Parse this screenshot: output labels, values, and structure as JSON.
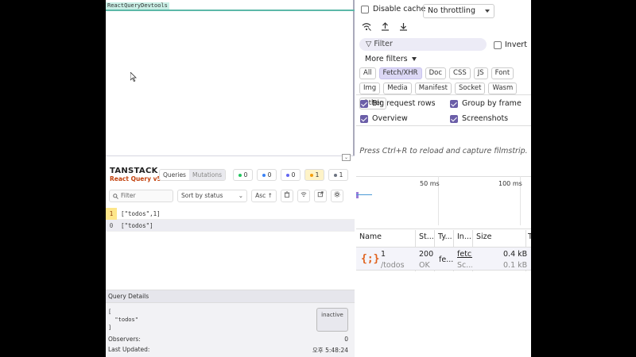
{
  "app": {
    "tab_title": "ReactQueryDevtools"
  },
  "react_query": {
    "brand_top": "TANSTACK",
    "brand_bottom": "React Query v5",
    "toggle_icon": "chevron-down-icon",
    "tabs": [
      {
        "label": "Queries",
        "active": true
      },
      {
        "label": "Mutations",
        "active": false
      }
    ],
    "counts": [
      {
        "value": "0",
        "color": "#22c55e"
      },
      {
        "value": "0",
        "color": "#3b82f6"
      },
      {
        "value": "0",
        "color": "#6366f1"
      },
      {
        "value": "1",
        "color": "#f59e0b"
      },
      {
        "value": "1",
        "color": "#6b7280"
      }
    ],
    "filter_placeholder": "Filter",
    "sort_label": "Sort by status",
    "asc_label": "Asc ↑",
    "rows": [
      {
        "count": "1",
        "key": "[\"todos\",1]"
      },
      {
        "count": "0",
        "key": "[\"todos\"]"
      }
    ],
    "details": {
      "header": "Query Details",
      "code": "[\n  \"todos\"\n]",
      "status": "inactive",
      "observers_label": "Observers:",
      "observers_value": "0",
      "updated_label": "Last Updated:",
      "updated_value": "오후 5:48:24"
    }
  },
  "devtools": {
    "disable_cache": "Disable cache",
    "throttling": "No throttling",
    "filter_placeholder": "Filter",
    "invert": "Invert",
    "more_filters": "More filters",
    "chips": [
      {
        "label": "All",
        "selected": false
      },
      {
        "label": "Fetch/XHR",
        "selected": true
      },
      {
        "label": "Doc",
        "selected": false
      },
      {
        "label": "CSS",
        "selected": false
      },
      {
        "label": "JS",
        "selected": false
      },
      {
        "label": "Font",
        "selected": false
      },
      {
        "label": "Img",
        "selected": false
      },
      {
        "label": "Media",
        "selected": false
      },
      {
        "label": "Manifest",
        "selected": false
      },
      {
        "label": "Socket",
        "selected": false
      },
      {
        "label": "Wasm",
        "selected": false
      },
      {
        "label": "Other",
        "selected": false
      }
    ],
    "options": {
      "big_rows": "Big request rows",
      "group_frame": "Group by frame",
      "overview": "Overview",
      "screenshots": "Screenshots"
    },
    "hint": "Press Ctrl+R to reload and capture filmstrip.",
    "timeline": {
      "t1": "50 ms",
      "t2": "100 ms"
    },
    "table": {
      "headers": {
        "name": "Name",
        "status": "St...",
        "type": "Ty...",
        "initiator": "In...",
        "size": "Size",
        "time": "T"
      },
      "row": {
        "name": "1",
        "path": "/todos",
        "status": "200",
        "status_text": "OK",
        "type": "fe...",
        "initiator": "fetch",
        "initiator_sub": "Sc...",
        "size": "0.4 kB",
        "size_sub": "0.1 kB"
      }
    }
  }
}
